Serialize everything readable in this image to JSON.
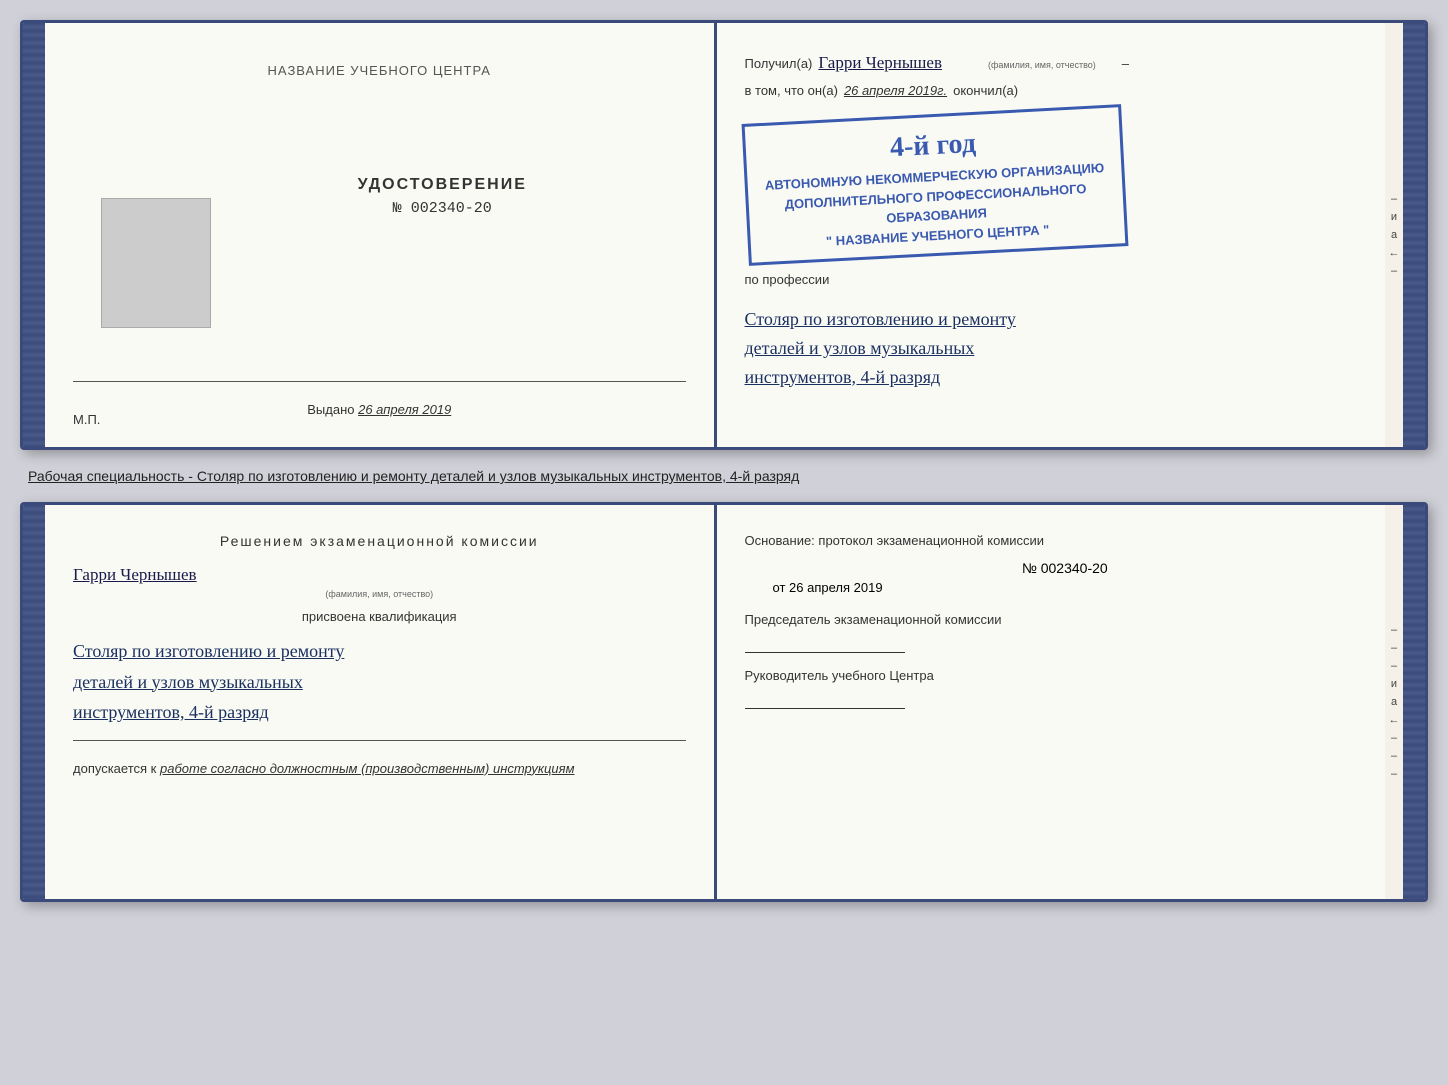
{
  "page": {
    "background": "#d0d0d8"
  },
  "upper_book": {
    "left_page": {
      "center_title": "НАЗВАНИЕ УЧЕБНОГО ЦЕНТРА",
      "cert_type": "УДОСТОВЕРЕНИЕ",
      "cert_number_prefix": "№",
      "cert_number": "002340-20",
      "issued_label": "Выдано",
      "issued_date": "26 апреля 2019",
      "mp_label": "М.П."
    },
    "right_page": {
      "received_label": "Получил(а)",
      "received_name": "Гарри Чернышев",
      "name_sublabel": "(фамилия, имя, отчество)",
      "in_that_label": "в том, что он(а)",
      "date_value": "26 апреля 2019г.",
      "finished_label": "окончил(а)",
      "stamp_line1": "АВТОНОМНУЮ НЕКОММЕРЧЕСКУЮ ОРГАНИЗАЦИЮ",
      "stamp_line2": "ДОПОЛНИТЕЛЬНОГО ПРОФЕССИОНАЛЬНОГО ОБРАЗОВАНИЯ",
      "stamp_line3": "\" НАЗВАНИЕ УЧЕБНОГО ЦЕНТРА \"",
      "stamp_large_text": "4-й год",
      "profession_label": "по профессии",
      "profession_line1": "Столяр по изготовлению и ремонту",
      "profession_line2": "деталей и узлов музыкальных",
      "profession_line3": "инструментов, 4-й разряд"
    }
  },
  "caption": {
    "text": "Рабочая специальность - Столяр по изготовлению и ремонту деталей и узлов музыкальных инструментов, 4-й разряд"
  },
  "lower_book": {
    "left_page": {
      "decision_title": "Решением  экзаменационной  комиссии",
      "person_name": "Гарри Чернышев",
      "name_sublabel": "(фамилия, имя, отчество)",
      "assigned_label": "присвоена квалификация",
      "qual_line1": "Столяр по изготовлению и ремонту",
      "qual_line2": "деталей и узлов музыкальных",
      "qual_line3": "инструментов, 4-й разряд",
      "допускается_label": "допускается к",
      "допускается_value": "работе согласно должностным (производственным) инструкциям"
    },
    "right_page": {
      "basis_label": "Основание: протокол экзаменационной  комиссии",
      "number_prefix": "№",
      "number_value": "002340-20",
      "date_prefix": "от",
      "date_value": "26 апреля 2019",
      "chairman_label": "Председатель экзаменационной комиссии",
      "director_label": "Руководитель учебного Центра"
    },
    "right_edge": {
      "chars": [
        "–",
        "–",
        "–",
        "и",
        "а",
        "←",
        "–",
        "–",
        "–",
        "–",
        "–"
      ]
    }
  }
}
